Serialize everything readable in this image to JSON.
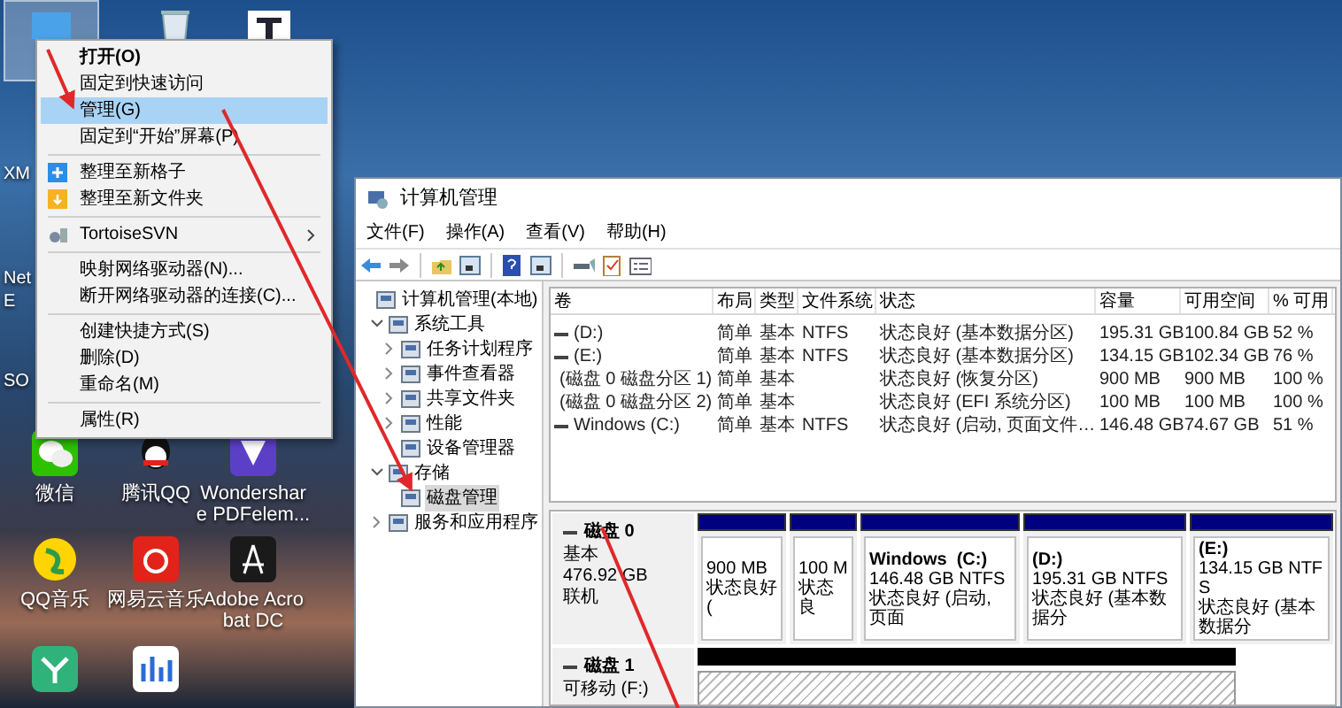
{
  "desktop": {
    "top_icons": [
      {
        "kind": "pc",
        "selected": true
      },
      {
        "kind": "recycle",
        "selected": false
      },
      {
        "kind": "font",
        "selected": false
      }
    ],
    "edge_labels": [
      {
        "label": "XM"
      },
      {
        "label": "Net"
      },
      {
        "label": "E"
      },
      {
        "label": "SO"
      }
    ],
    "icons": [
      {
        "kind": "wechat",
        "lines": [
          "微信"
        ]
      },
      {
        "kind": "qq",
        "lines": [
          "腾讯QQ"
        ]
      },
      {
        "kind": "pdf",
        "lines": [
          "Wondershar",
          "e PDFelem..."
        ]
      },
      {
        "kind": "music",
        "lines": [
          "QQ音乐"
        ]
      },
      {
        "kind": "netease",
        "lines": [
          "网易云音乐"
        ]
      },
      {
        "kind": "acrobat",
        "lines": [
          "Adobe Acro",
          "bat DC"
        ]
      },
      {
        "kind": "mind"
      },
      {
        "kind": "huawei"
      }
    ]
  },
  "context_menu": {
    "groups": [
      [
        {
          "label": "打开(O)",
          "selected": false,
          "bold": true
        },
        {
          "label": "固定到快速访问",
          "selected": false
        },
        {
          "label": "管理(G)",
          "selected": true
        },
        {
          "label": "固定到“开始”屏幕(P)",
          "selected": false
        }
      ],
      [
        {
          "label": "整理至新格子",
          "selected": false
        },
        {
          "label": "整理至新文件夹",
          "selected": false
        }
      ],
      [
        {
          "label": "TortoiseSVN",
          "selected": false,
          "submenu": true
        }
      ],
      [
        {
          "label": "映射网络驱动器(N)...",
          "selected": false
        },
        {
          "label": "断开网络驱动器的连接(C)...",
          "selected": false
        }
      ],
      [
        {
          "label": "创建快捷方式(S)",
          "selected": false
        },
        {
          "label": "删除(D)",
          "selected": false
        },
        {
          "label": "重命名(M)",
          "selected": false
        }
      ],
      [
        {
          "label": "属性(R)",
          "selected": false
        }
      ]
    ]
  },
  "window": {
    "title": "计算机管理",
    "menu": [
      "文件(F)",
      "操作(A)",
      "查看(V)",
      "帮助(H)"
    ],
    "tree": [
      {
        "label": "计算机管理(本地)",
        "selected": false,
        "children": [
          {
            "label": "系统工具",
            "selected": false,
            "expanded": true,
            "children": [
              {
                "label": "任务计划程序",
                "selected": false,
                "expanded": false
              },
              {
                "label": "事件查看器",
                "selected": false,
                "expanded": false
              },
              {
                "label": "共享文件夹",
                "selected": false,
                "expanded": false
              },
              {
                "label": "性能",
                "selected": false,
                "expanded": false
              },
              {
                "label": "设备管理器",
                "selected": false
              }
            ]
          },
          {
            "label": "存储",
            "selected": false,
            "expanded": true,
            "children": [
              {
                "label": "磁盘管理",
                "selected": true
              }
            ]
          },
          {
            "label": "服务和应用程序",
            "selected": false,
            "expanded": false
          }
        ]
      }
    ],
    "table": {
      "columns": [
        "卷",
        "布局",
        "类型",
        "文件系统",
        "状态",
        "容量",
        "可用空间",
        "% 可用"
      ],
      "rows": [
        [
          "(D:)",
          "简单",
          "基本",
          "NTFS",
          "状态良好 (基本数据分区)",
          "195.31 GB",
          "100.84 GB",
          "52 %"
        ],
        [
          "(E:)",
          "简单",
          "基本",
          "NTFS",
          "状态良好 (基本数据分区)",
          "134.15 GB",
          "102.34 GB",
          "76 %"
        ],
        [
          "(磁盘 0 磁盘分区 1)",
          "简单",
          "基本",
          "",
          "状态良好 (恢复分区)",
          "900 MB",
          "900 MB",
          "100 %"
        ],
        [
          "(磁盘 0 磁盘分区 2)",
          "简单",
          "基本",
          "",
          "状态良好 (EFI 系统分区)",
          "100 MB",
          "100 MB",
          "100 %"
        ],
        [
          "Windows (C:)",
          "简单",
          "基本",
          "NTFS",
          "状态良好 (启动, 页面文件…",
          "146.48 GB",
          "74.67 GB",
          "51 %"
        ]
      ]
    },
    "disks": [
      {
        "kind": "basic",
        "name": "磁盘 0",
        "lines": [
          "基本",
          "476.92 GB",
          "联机"
        ],
        "partitions": [
          {
            "size": "900 MB",
            "status": "状态良好 ("
          },
          {
            "size": "100 M",
            "status": "状态良"
          },
          {
            "title": "Windows  (C:)",
            "size": "146.48 GB NTFS",
            "status": "状态良好 (启动, 页面"
          },
          {
            "title": "(D:)",
            "size": "195.31 GB NTFS",
            "status": "状态良好 (基本数据分"
          },
          {
            "title": "(E:)",
            "size": "134.15 GB NTFS",
            "status": "状态良好 (基本数据分"
          }
        ]
      },
      {
        "kind": "removable",
        "name": "磁盘 1",
        "lines": [
          "可移动 (F:)"
        ]
      }
    ]
  }
}
